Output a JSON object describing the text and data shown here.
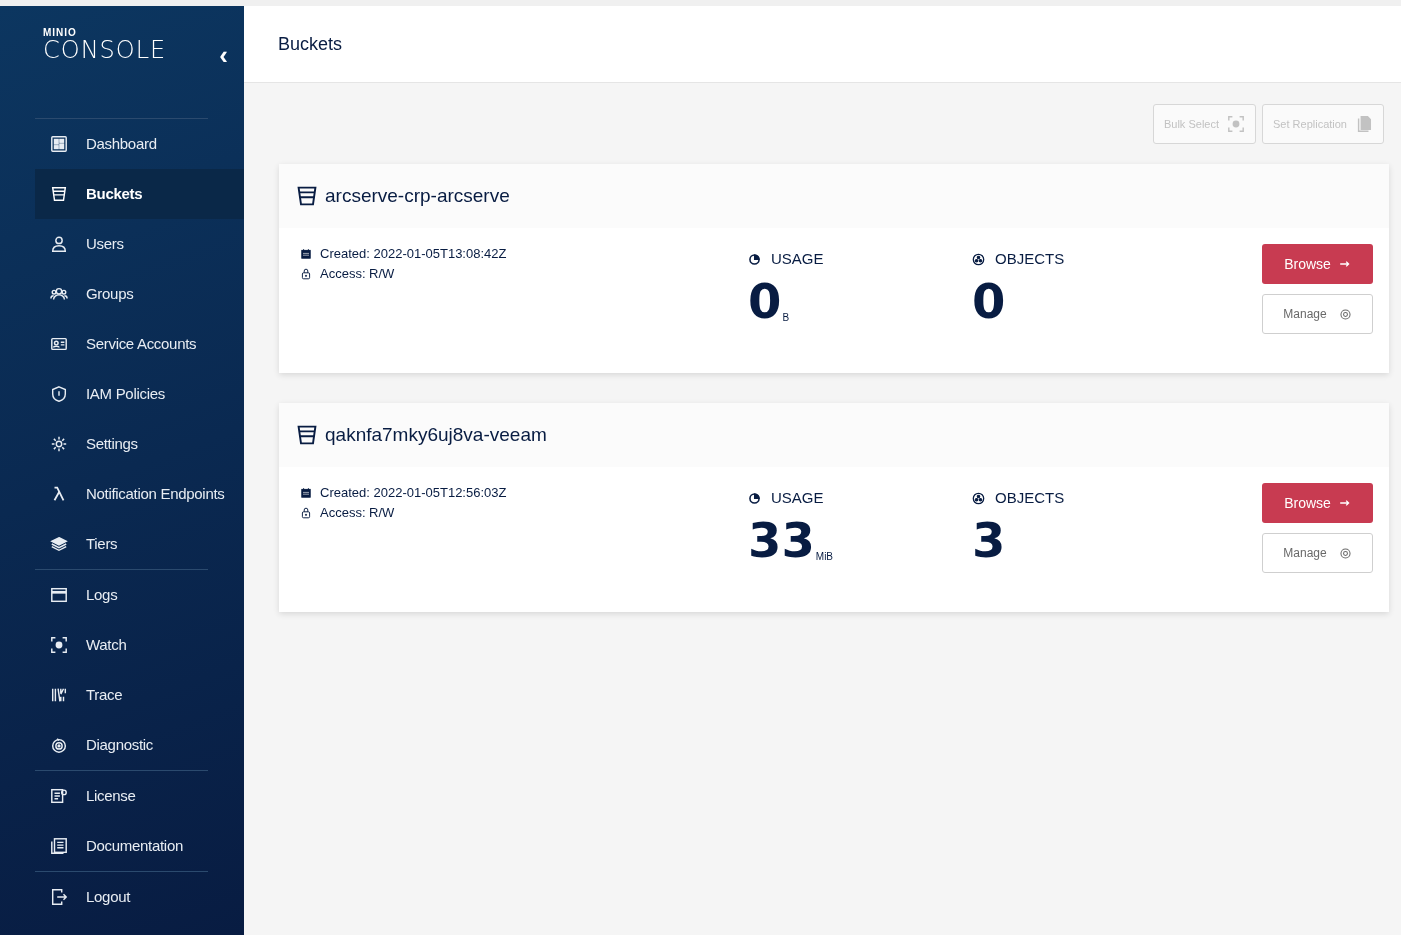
{
  "sidebar": {
    "logo_small": "MINIO",
    "logo": "CONSOLE",
    "collapse": "‹",
    "groups": [
      [
        {
          "label": "Dashboard",
          "selected": false
        },
        {
          "label": "Buckets",
          "selected": true
        },
        {
          "label": "Users",
          "selected": false
        },
        {
          "label": "Groups",
          "selected": false
        },
        {
          "label": "Service Accounts",
          "selected": false
        },
        {
          "label": "IAM Policies",
          "selected": false
        },
        {
          "label": "Settings",
          "selected": false
        },
        {
          "label": "Notification Endpoints",
          "selected": false
        },
        {
          "label": "Tiers",
          "selected": false
        }
      ],
      [
        {
          "label": "Logs",
          "selected": false
        },
        {
          "label": "Watch",
          "selected": false
        },
        {
          "label": "Trace",
          "selected": false
        },
        {
          "label": "Diagnostic",
          "selected": false
        }
      ],
      [
        {
          "label": "License",
          "selected": false
        },
        {
          "label": "Documentation",
          "selected": false
        }
      ],
      [
        {
          "label": "Logout",
          "selected": false
        }
      ]
    ]
  },
  "header": {
    "title": "Buckets"
  },
  "toolbar": [
    {
      "label": "Bulk Select",
      "disabled": true
    },
    {
      "label": "Set Replication",
      "disabled": true
    }
  ],
  "buckets": [
    {
      "name": "arcserve-crp-arcserve",
      "created_label": "Created:",
      "created": "2022-01-05T13:08:42Z",
      "access_label": "Access:",
      "access": "R/W",
      "usage_label": "USAGE",
      "usage": "0",
      "usage_unit": "B",
      "objects_label": "OBJECTS",
      "objects": "0",
      "browse": "Browse",
      "manage": "Manage"
    },
    {
      "name": "qaknfa7mky6uj8va-veeam",
      "created_label": "Created:",
      "created": "2022-01-05T12:56:03Z",
      "access_label": "Access:",
      "access": "R/W",
      "usage_label": "USAGE",
      "usage": "33",
      "usage_unit": "MiB",
      "objects_label": "OBJECTS",
      "objects": "3",
      "browse": "Browse",
      "manage": "Manage"
    }
  ]
}
